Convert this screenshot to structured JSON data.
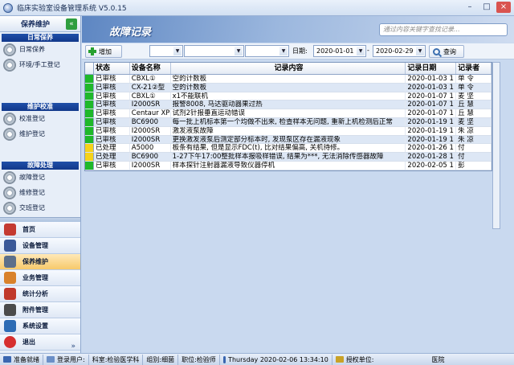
{
  "window": {
    "title": "临床实验室设备管理系统  V5.0.15"
  },
  "sidebar": {
    "header": "保养维护",
    "sections": [
      {
        "title": "日常保养",
        "items": [
          "日常保养",
          "环境/手工登记"
        ]
      },
      {
        "title": "维护校准",
        "items": [
          "校准登记",
          "维护登记"
        ]
      },
      {
        "title": "故障处理",
        "items": [
          "故障登记",
          "维修登记",
          "交班登记"
        ]
      }
    ],
    "nav": [
      {
        "label": "首页",
        "icon_color": "#c43a31"
      },
      {
        "label": "设备管理",
        "icon_color": "#3b5998"
      },
      {
        "label": "保养维护",
        "icon_color": "#5c6f8a"
      },
      {
        "label": "业务管理",
        "icon_color": "#d9822b"
      },
      {
        "label": "统计分析",
        "icon_color": "#c0392b"
      },
      {
        "label": "附件管理",
        "icon_color": "#4b4b4b"
      },
      {
        "label": "系统设置",
        "icon_color": "#2d6cb5"
      },
      {
        "label": "退出",
        "icon_color": "#d62f2f"
      }
    ],
    "more": "»"
  },
  "main": {
    "title": "故障记录",
    "search_placeholder": "通过内容关键字查找记录...",
    "toolbar": {
      "add_label": "增加",
      "combo1": "",
      "combo2": "",
      "combo3": "",
      "date_label": "日期:",
      "date_from": "2020-01-01",
      "date_sep": "-",
      "date_to": "2020-02-29",
      "query_label": "查询"
    },
    "table": {
      "columns": [
        "状态",
        "设备名称",
        "记录内容",
        "记录日期",
        "记录者"
      ],
      "rows": [
        {
          "indicator": "#1fb82a",
          "status": "已审核",
          "device": "CBXL①",
          "content": "空的计数板",
          "date": "2020-01-03 1",
          "user": "单 令"
        },
        {
          "indicator": "#1fb82a",
          "status": "已审核",
          "device": "CX-21②型",
          "content": "空的计数板",
          "date": "2020-01-03 1",
          "user": "单 令"
        },
        {
          "indicator": "#1fb82a",
          "status": "已审核",
          "device": "CBXL①",
          "content": "x1不能联机",
          "date": "2020-01-07 1",
          "user": "麦 坚"
        },
        {
          "indicator": "#1fb82a",
          "status": "已审核",
          "device": "I2000SR",
          "content": "报警8008, 马达驱动器果过热",
          "date": "2020-01-07 1",
          "user": "丘 慧"
        },
        {
          "indicator": "#1fb82a",
          "status": "已审核",
          "device": "Centaur XP",
          "content": "试剂2针报垂直运动错误",
          "date": "2020-01-07 1",
          "user": "丘 慧"
        },
        {
          "indicator": "#1fb82a",
          "status": "已审核",
          "device": "BC6900",
          "content": "每一批上机标本第一个均做不出来, 检查样本无问题, 重新上机检测后正常",
          "date": "2020-01-19 1",
          "user": "麦 坚"
        },
        {
          "indicator": "#1fb82a",
          "status": "已审核",
          "device": "I2000SR",
          "content": "激发液泵故障",
          "date": "2020-01-19 1",
          "user": "朱 凉"
        },
        {
          "indicator": "#1fb82a",
          "status": "已审核",
          "device": "I2000SR",
          "content": "更换激发液泵后测定部分标本时, 发现泵区存在漏液现象",
          "date": "2020-01-19 1",
          "user": "朱 凉"
        },
        {
          "indicator": "#f5d21a",
          "status": "已处理",
          "device": "A5000",
          "content": "板条有结果, 但是显示FDC(t), 比对结果偏高, 关机待修。",
          "date": "2020-01-26 1",
          "user": "付 "
        },
        {
          "indicator": "#f5d21a",
          "status": "已处理",
          "device": "BC6900",
          "content": "1-27下午17:00整批样本报吸样错误, 结果为***, 无法消除传感器故障",
          "date": "2020-01-28 1",
          "user": "付 "
        },
        {
          "indicator": "#1fb82a",
          "status": "已审核",
          "device": "I2000SR",
          "content": "样本探针注射器漏液导致仪器停机",
          "date": "2020-02-05 1",
          "user": "彭 "
        }
      ]
    }
  },
  "statusbar": {
    "ready": "准备就绪",
    "login_user": "登录用户:",
    "dept": "科室:检验医学科",
    "group": "组别:细菌",
    "position": "职位:检验师",
    "datetime": "Thursday 2020-02-06 13:34:10",
    "licensed": "授权单位:",
    "licensed_org": "医院"
  },
  "colors": {
    "accent": "#1f4fa8",
    "banner": "#5d86c2",
    "alt_row": "#dde7f5"
  }
}
